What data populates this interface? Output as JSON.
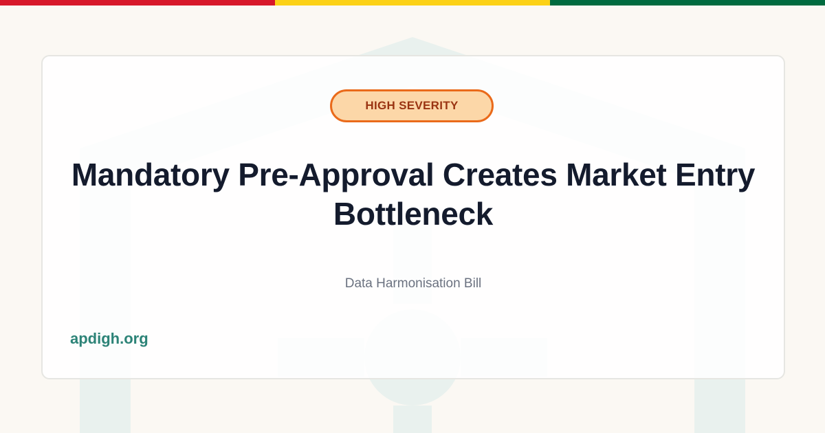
{
  "colors": {
    "page_background": "#fbf8f3",
    "flag_red": "#d7182a",
    "flag_yellow": "#fcd116",
    "flag_green": "#006b3f",
    "watermark": "#e9f1ee",
    "badge_fill": "#fcd7a8",
    "badge_border": "#ea6a1a",
    "badge_text": "#9a3412",
    "title_text": "#141b2d",
    "subtitle_text": "#6b7280",
    "domain_text": "#2c8377"
  },
  "badge": {
    "label": "HIGH SEVERITY"
  },
  "headline": {
    "text": "Mandatory Pre-Approval Creates Market Entry Bottleneck"
  },
  "source": {
    "label": "Data Harmonisation Bill"
  },
  "footer": {
    "domain": "apdigh.org"
  },
  "watermark": {
    "icon": "house-crosshair-icon"
  }
}
